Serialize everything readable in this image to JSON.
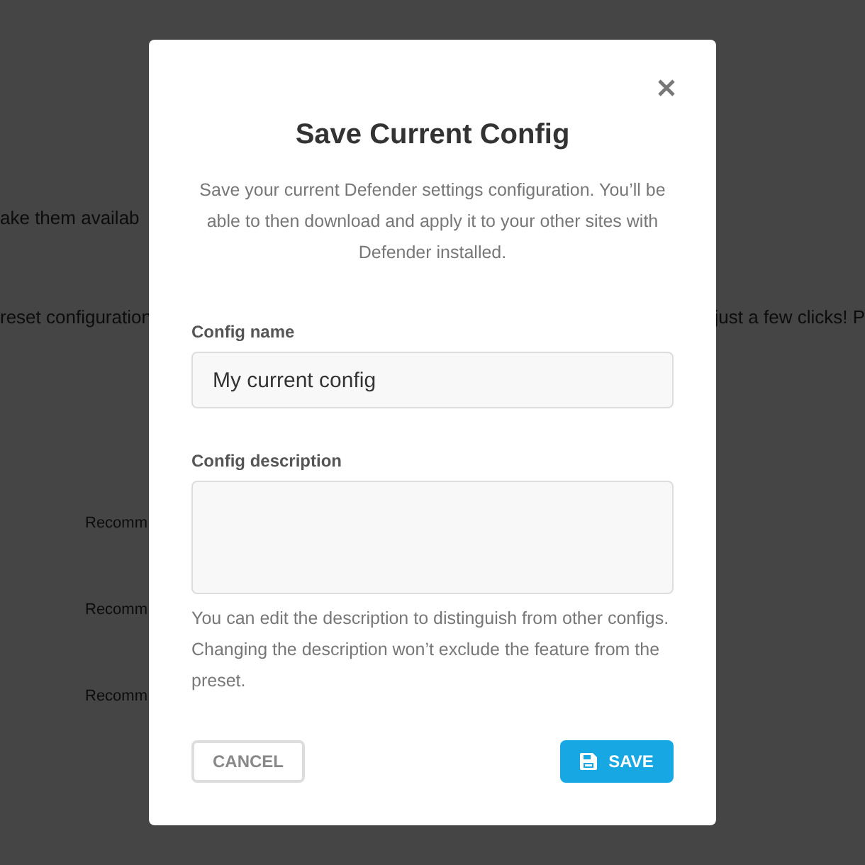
{
  "background": {
    "lines": [
      {
        "left": "ake them availab"
      },
      {
        "left": "reset configuration",
        "right": "just a few clicks! P"
      }
    ],
    "rows": [
      "Recomm",
      "Recomm",
      "Recomm"
    ]
  },
  "dialog": {
    "title": "Save Current Config",
    "description": "Save your current Defender settings configuration. You’ll be able to then download and apply it to your other sites with Defender installed.",
    "fields": [
      {
        "kind": "input",
        "label": "Config name",
        "value": "My current config"
      },
      {
        "kind": "textarea",
        "label": "Config description",
        "help": "You can edit the description to distinguish from other configs. Changing the description won’t exclude the feature from the preset."
      }
    ],
    "buttons": [
      {
        "kind": "ghost",
        "label": "CANCEL"
      },
      {
        "kind": "primary",
        "label": "SAVE"
      }
    ]
  }
}
